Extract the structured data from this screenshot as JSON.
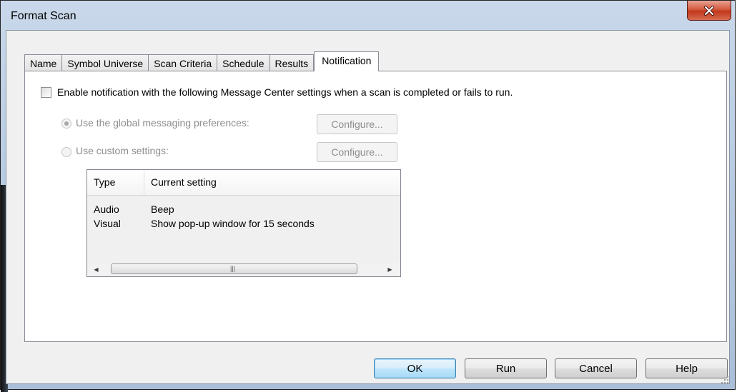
{
  "window": {
    "title": "Format Scan"
  },
  "tabs": [
    {
      "label": "Name"
    },
    {
      "label": "Symbol Universe"
    },
    {
      "label": "Scan Criteria"
    },
    {
      "label": "Schedule"
    },
    {
      "label": "Results"
    },
    {
      "label": "Notification"
    }
  ],
  "active_tab": "Notification",
  "notification": {
    "enable_label": "Enable notification with the following Message Center settings when a scan is completed or fails to run.",
    "enable_checked": false,
    "global_option_label": "Use the global messaging preferences:",
    "custom_option_label": "Use custom settings:",
    "global_selected": true,
    "configure_label": "Configure...",
    "list": {
      "columns": [
        "Type",
        "Current setting"
      ],
      "rows": [
        {
          "type": "Audio",
          "setting": "Beep"
        },
        {
          "type": "Visual",
          "setting": "Show pop-up window for 15 seconds"
        }
      ]
    }
  },
  "buttons": {
    "ok": "OK",
    "run": "Run",
    "cancel": "Cancel",
    "help": "Help"
  },
  "colors": {
    "title_bar": "#b7cbe2",
    "close_button": "#c1381c",
    "disabled_text": "#8d8d8d",
    "default_button": "#bee6fd"
  }
}
